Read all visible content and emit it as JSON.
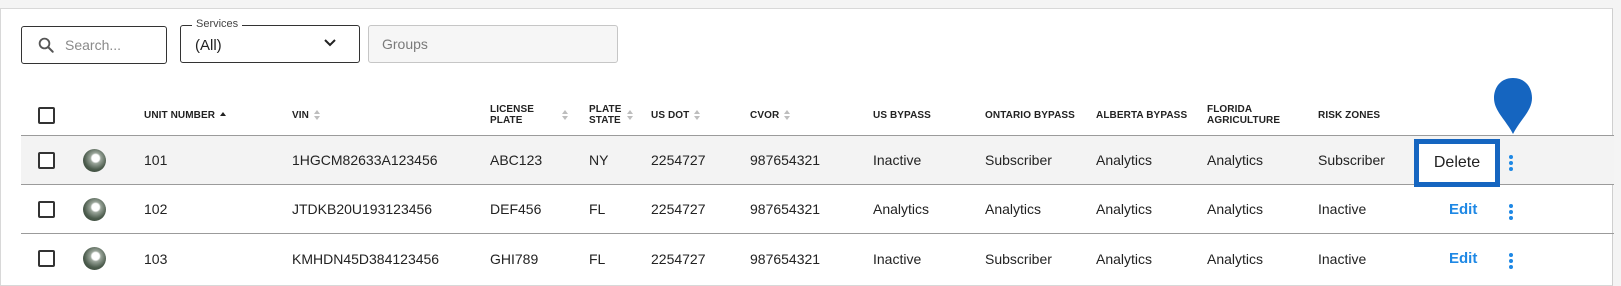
{
  "filters": {
    "search_placeholder": "Search...",
    "services_label": "Services",
    "services_value": "(All)",
    "groups_placeholder": "Groups"
  },
  "columns": {
    "unit_number": "UNIT NUMBER",
    "vin": "VIN",
    "license_plate_1": "LICENSE",
    "license_plate_2": "PLATE",
    "plate_state_1": "PLATE",
    "plate_state_2": "STATE",
    "us_dot": "US DOT",
    "cvor": "CVOR",
    "us_bypass": "US BYPASS",
    "ontario_bypass": "ONTARIO BYPASS",
    "alberta_bypass": "ALBERTA BYPASS",
    "florida_agriculture_1": "FLORIDA",
    "florida_agriculture_2": "AGRICULTURE",
    "risk_zones": "RISK ZONES"
  },
  "rows": [
    {
      "unit": "101",
      "vin": "1HGCM82633A123456",
      "plate": "ABC123",
      "state": "NY",
      "usdot": "2254727",
      "cvor": "987654321",
      "us_bypass": "Inactive",
      "ontario_bypass": "Subscriber",
      "alberta_bypass": "Analytics",
      "florida_agriculture": "Analytics",
      "risk_zones": "Subscriber",
      "action": "Delete"
    },
    {
      "unit": "102",
      "vin": "JTDKB20U193123456",
      "plate": "DEF456",
      "state": "FL",
      "usdot": "2254727",
      "cvor": "987654321",
      "us_bypass": "Analytics",
      "ontario_bypass": "Analytics",
      "alberta_bypass": "Analytics",
      "florida_agriculture": "Analytics",
      "risk_zones": "Inactive",
      "action": "Edit"
    },
    {
      "unit": "103",
      "vin": "KMHDN45D384123456",
      "plate": "GHI789",
      "state": "FL",
      "usdot": "2254727",
      "cvor": "987654321",
      "us_bypass": "Inactive",
      "ontario_bypass": "Subscriber",
      "alberta_bypass": "Analytics",
      "florida_agriculture": "Analytics",
      "risk_zones": "Inactive",
      "action": "Edit"
    }
  ],
  "colors": {
    "accent": "#1e88e5",
    "highlight_border": "#1565c0",
    "row_hover": "#f3f3f3"
  },
  "icons": [
    "search-icon",
    "chevron-down-icon",
    "sort-icon",
    "more-vert-icon",
    "pin-marker-icon",
    "avatar"
  ]
}
